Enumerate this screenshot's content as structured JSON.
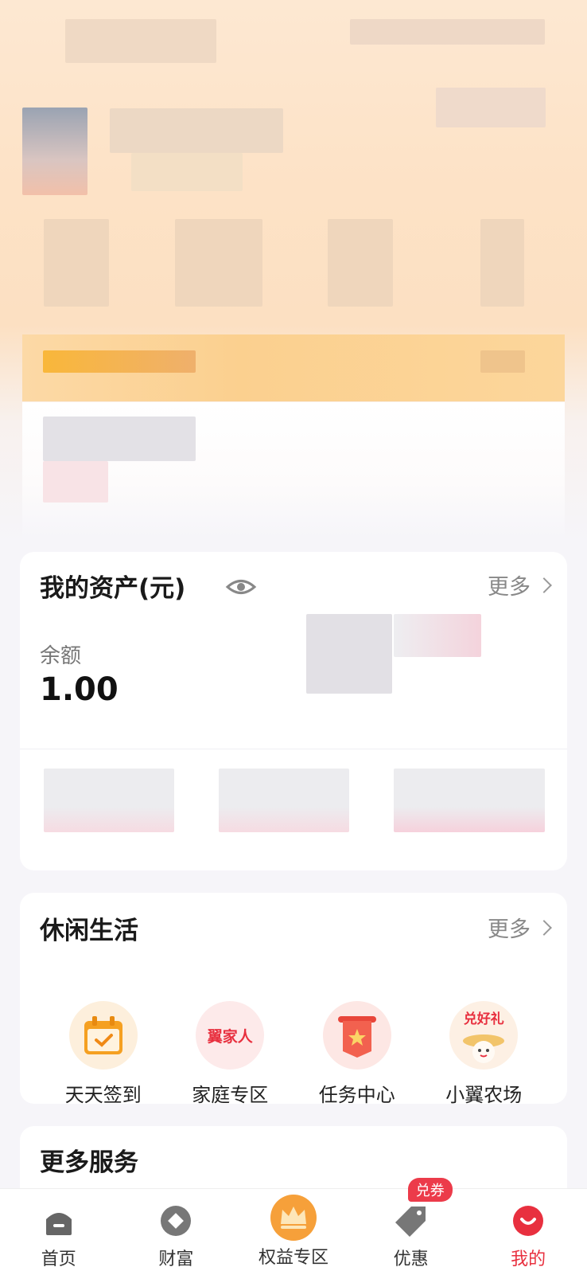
{
  "assets": {
    "title": "我的资产(元)",
    "more": "更多",
    "balance_label": "余额",
    "balance_value": "1.00"
  },
  "leisure": {
    "title": "休闲生活",
    "more": "更多",
    "items": [
      {
        "label": "天天签到",
        "icon": "calendar-check-icon",
        "color": "#f5a021"
      },
      {
        "label": "家庭专区",
        "icon": "family-text-icon",
        "badge_text": "翼家人",
        "color": "#e8303f"
      },
      {
        "label": "任务中心",
        "icon": "task-banner-icon",
        "color": "#e8463a"
      },
      {
        "label": "小翼农场",
        "icon": "farm-mascot-icon",
        "badge_text": "兑好礼",
        "color": "#e8303f"
      }
    ]
  },
  "more_services": {
    "title": "更多服务"
  },
  "tabbar": {
    "items": [
      {
        "label": "首页",
        "icon": "home-icon"
      },
      {
        "label": "财富",
        "icon": "wealth-icon"
      },
      {
        "label": "权益专区",
        "icon": "crown-icon"
      },
      {
        "label": "优惠",
        "icon": "tag-icon",
        "badge": "兑券"
      },
      {
        "label": "我的",
        "icon": "profile-icon",
        "active": true
      }
    ]
  },
  "colors": {
    "accent": "#e8303f",
    "header_bg": "#fde2c6"
  }
}
